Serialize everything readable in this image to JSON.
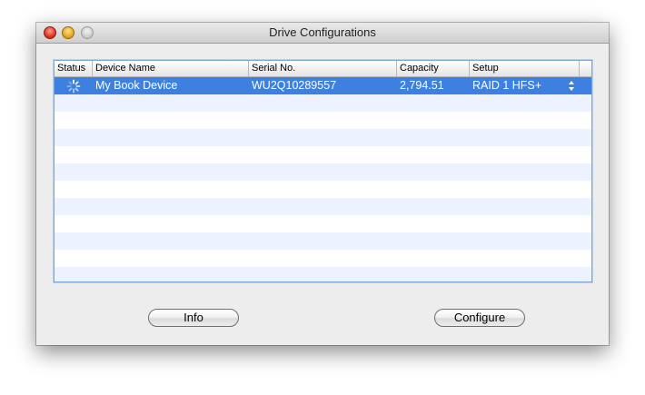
{
  "window": {
    "title": "Drive Configurations"
  },
  "table": {
    "columns": [
      "Status",
      "Device Name",
      "Serial No.",
      "Capacity",
      "Setup"
    ],
    "rows": [
      {
        "status": "spinner-icon",
        "device_name": "My Book Device",
        "serial_no": "WU2Q10289557",
        "capacity": "2,794.51",
        "setup": "RAID 1 HFS+"
      }
    ],
    "selection_color": "#3d80df",
    "stripe_color": "#edf3fe"
  },
  "buttons": {
    "info": "Info",
    "configure": "Configure"
  }
}
